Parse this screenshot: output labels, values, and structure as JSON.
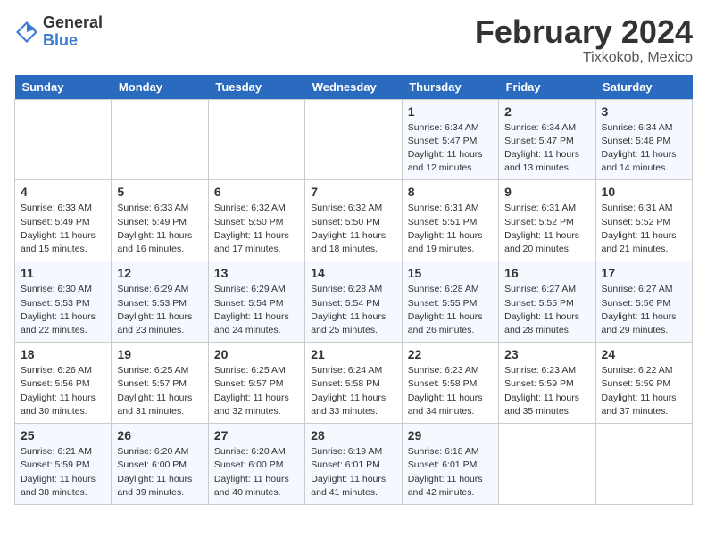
{
  "logo": {
    "general": "General",
    "blue": "Blue"
  },
  "title": "February 2024",
  "location": "Tixkokob, Mexico",
  "days_of_week": [
    "Sunday",
    "Monday",
    "Tuesday",
    "Wednesday",
    "Thursday",
    "Friday",
    "Saturday"
  ],
  "weeks": [
    [
      {
        "day": "",
        "info": ""
      },
      {
        "day": "",
        "info": ""
      },
      {
        "day": "",
        "info": ""
      },
      {
        "day": "",
        "info": ""
      },
      {
        "day": "1",
        "info": "Sunrise: 6:34 AM\nSunset: 5:47 PM\nDaylight: 11 hours and 12 minutes."
      },
      {
        "day": "2",
        "info": "Sunrise: 6:34 AM\nSunset: 5:47 PM\nDaylight: 11 hours and 13 minutes."
      },
      {
        "day": "3",
        "info": "Sunrise: 6:34 AM\nSunset: 5:48 PM\nDaylight: 11 hours and 14 minutes."
      }
    ],
    [
      {
        "day": "4",
        "info": "Sunrise: 6:33 AM\nSunset: 5:49 PM\nDaylight: 11 hours and 15 minutes."
      },
      {
        "day": "5",
        "info": "Sunrise: 6:33 AM\nSunset: 5:49 PM\nDaylight: 11 hours and 16 minutes."
      },
      {
        "day": "6",
        "info": "Sunrise: 6:32 AM\nSunset: 5:50 PM\nDaylight: 11 hours and 17 minutes."
      },
      {
        "day": "7",
        "info": "Sunrise: 6:32 AM\nSunset: 5:50 PM\nDaylight: 11 hours and 18 minutes."
      },
      {
        "day": "8",
        "info": "Sunrise: 6:31 AM\nSunset: 5:51 PM\nDaylight: 11 hours and 19 minutes."
      },
      {
        "day": "9",
        "info": "Sunrise: 6:31 AM\nSunset: 5:52 PM\nDaylight: 11 hours and 20 minutes."
      },
      {
        "day": "10",
        "info": "Sunrise: 6:31 AM\nSunset: 5:52 PM\nDaylight: 11 hours and 21 minutes."
      }
    ],
    [
      {
        "day": "11",
        "info": "Sunrise: 6:30 AM\nSunset: 5:53 PM\nDaylight: 11 hours and 22 minutes."
      },
      {
        "day": "12",
        "info": "Sunrise: 6:29 AM\nSunset: 5:53 PM\nDaylight: 11 hours and 23 minutes."
      },
      {
        "day": "13",
        "info": "Sunrise: 6:29 AM\nSunset: 5:54 PM\nDaylight: 11 hours and 24 minutes."
      },
      {
        "day": "14",
        "info": "Sunrise: 6:28 AM\nSunset: 5:54 PM\nDaylight: 11 hours and 25 minutes."
      },
      {
        "day": "15",
        "info": "Sunrise: 6:28 AM\nSunset: 5:55 PM\nDaylight: 11 hours and 26 minutes."
      },
      {
        "day": "16",
        "info": "Sunrise: 6:27 AM\nSunset: 5:55 PM\nDaylight: 11 hours and 28 minutes."
      },
      {
        "day": "17",
        "info": "Sunrise: 6:27 AM\nSunset: 5:56 PM\nDaylight: 11 hours and 29 minutes."
      }
    ],
    [
      {
        "day": "18",
        "info": "Sunrise: 6:26 AM\nSunset: 5:56 PM\nDaylight: 11 hours and 30 minutes."
      },
      {
        "day": "19",
        "info": "Sunrise: 6:25 AM\nSunset: 5:57 PM\nDaylight: 11 hours and 31 minutes."
      },
      {
        "day": "20",
        "info": "Sunrise: 6:25 AM\nSunset: 5:57 PM\nDaylight: 11 hours and 32 minutes."
      },
      {
        "day": "21",
        "info": "Sunrise: 6:24 AM\nSunset: 5:58 PM\nDaylight: 11 hours and 33 minutes."
      },
      {
        "day": "22",
        "info": "Sunrise: 6:23 AM\nSunset: 5:58 PM\nDaylight: 11 hours and 34 minutes."
      },
      {
        "day": "23",
        "info": "Sunrise: 6:23 AM\nSunset: 5:59 PM\nDaylight: 11 hours and 35 minutes."
      },
      {
        "day": "24",
        "info": "Sunrise: 6:22 AM\nSunset: 5:59 PM\nDaylight: 11 hours and 37 minutes."
      }
    ],
    [
      {
        "day": "25",
        "info": "Sunrise: 6:21 AM\nSunset: 5:59 PM\nDaylight: 11 hours and 38 minutes."
      },
      {
        "day": "26",
        "info": "Sunrise: 6:20 AM\nSunset: 6:00 PM\nDaylight: 11 hours and 39 minutes."
      },
      {
        "day": "27",
        "info": "Sunrise: 6:20 AM\nSunset: 6:00 PM\nDaylight: 11 hours and 40 minutes."
      },
      {
        "day": "28",
        "info": "Sunrise: 6:19 AM\nSunset: 6:01 PM\nDaylight: 11 hours and 41 minutes."
      },
      {
        "day": "29",
        "info": "Sunrise: 6:18 AM\nSunset: 6:01 PM\nDaylight: 11 hours and 42 minutes."
      },
      {
        "day": "",
        "info": ""
      },
      {
        "day": "",
        "info": ""
      }
    ]
  ]
}
